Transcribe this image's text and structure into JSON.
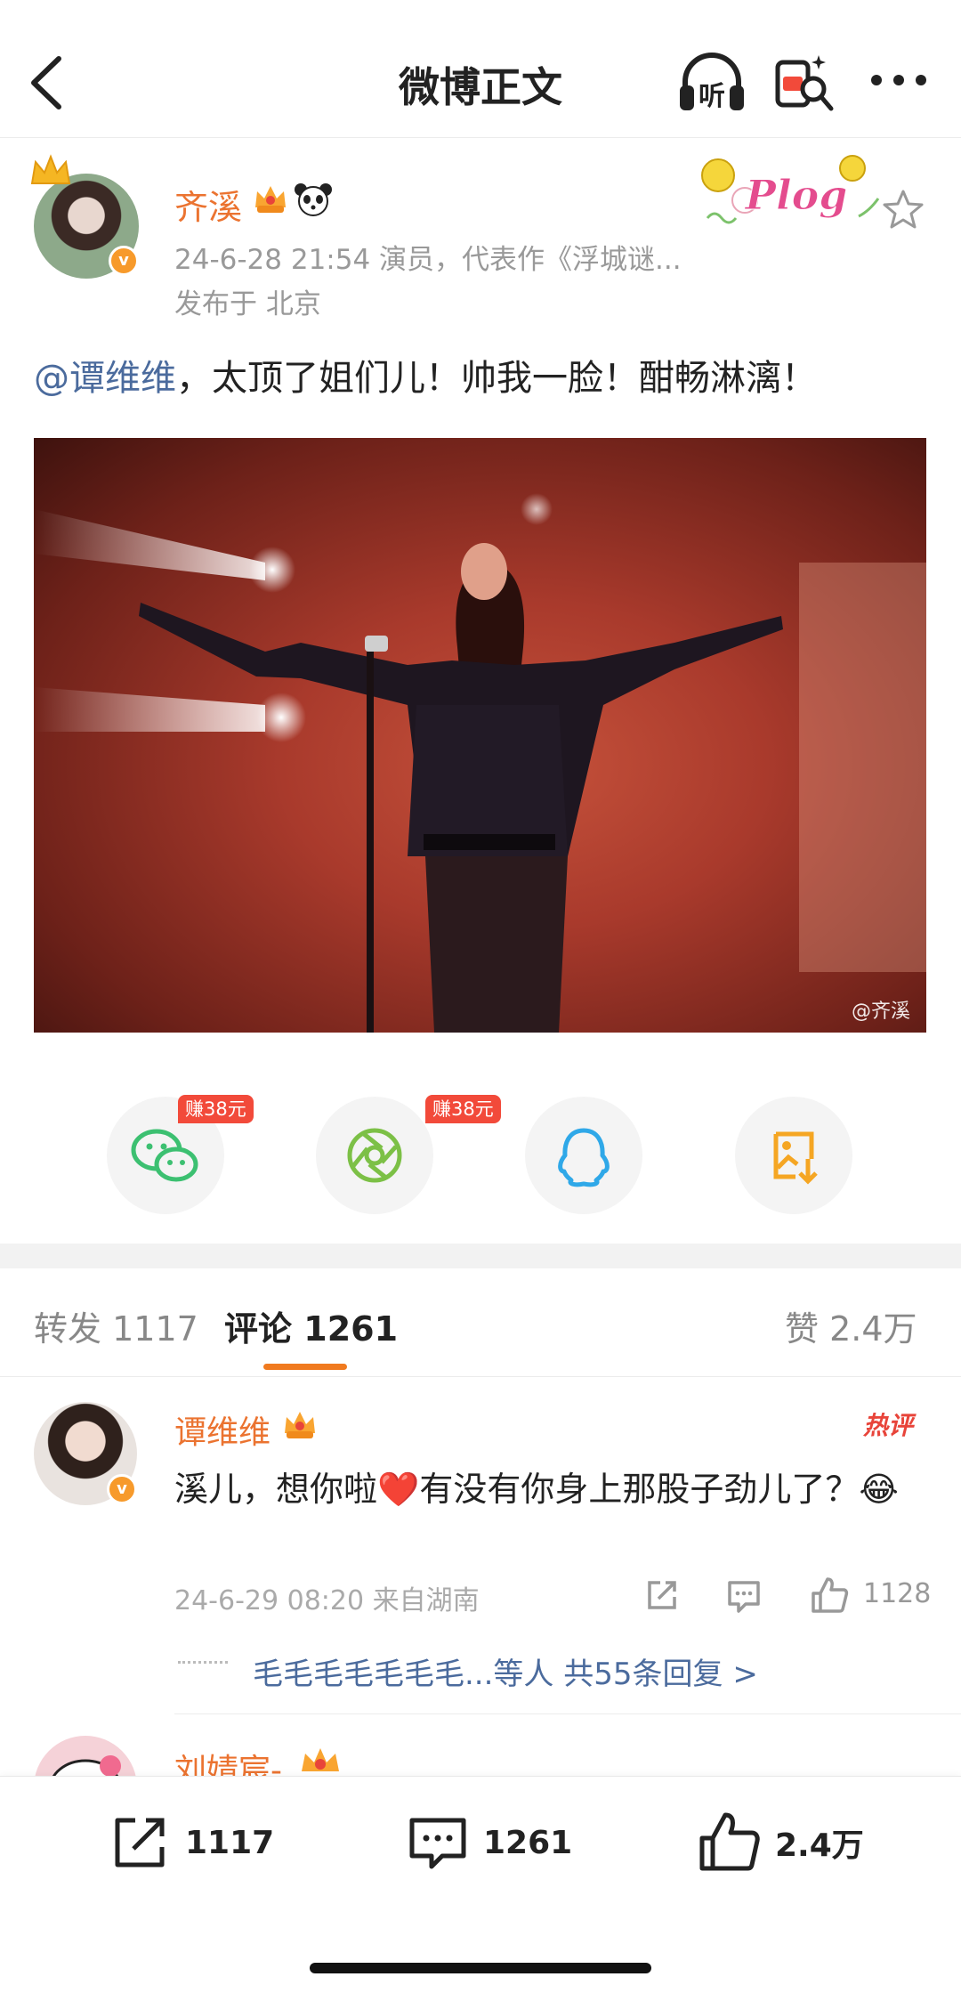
{
  "header": {
    "title": "微博正文",
    "listen_label": "听"
  },
  "post": {
    "author": "齐溪",
    "meta": "24-6-28 21:54  演员，代表作《浮城谜...",
    "location": "发布于 北京",
    "mention": "@谭维维",
    "body": "，太顶了姐们儿！帅我一脸！酣畅淋漓！",
    "watermark": "@齐溪",
    "plog_label": "Plog",
    "v_badge": "v"
  },
  "share": {
    "badge_wechat": "赚38元",
    "badge_moments": "赚38元",
    "items": [
      "wechat-icon",
      "moments-icon",
      "qq-icon",
      "save-image-icon"
    ]
  },
  "tabs": {
    "repost_label": "转发",
    "repost_count": "1117",
    "comment_label": "评论",
    "comment_count": "1261",
    "like_label": "赞",
    "like_count": "2.4万"
  },
  "comments": [
    {
      "name": "谭维维",
      "tag": "热评",
      "text": "溪儿，想你啦❤️有没有你身上那股子劲儿了？😂",
      "time": "24-6-29 08:20  来自湖南",
      "likes": "1128",
      "replies_names": "毛毛毛毛毛毛毛...等人",
      "replies_count": "共55条回复 >"
    },
    {
      "name": "刘婧宸-"
    }
  ],
  "bottom_bar": {
    "repost": "1117",
    "comment": "1261",
    "like": "2.4万"
  },
  "colors": {
    "accent": "#eb7330",
    "link": "#4b6b9d",
    "hot": "#e8443a",
    "badge": "#f24a3a"
  }
}
